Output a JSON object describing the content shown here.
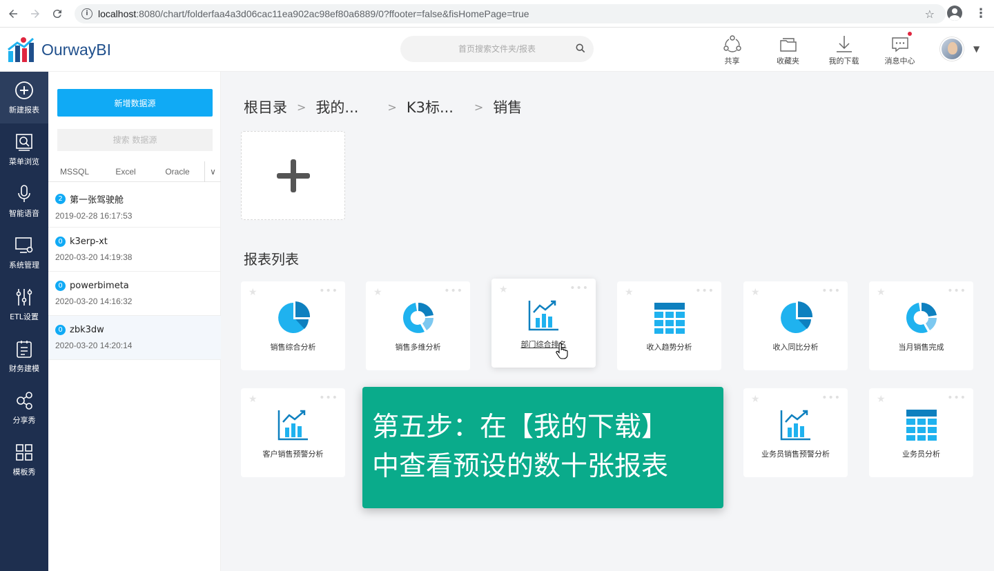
{
  "browser": {
    "url_host": "localhost",
    "url_rest": ":8080/chart/folderfaa4a3d06cac11ea902ac98ef80a6889/0?ffooter=false&fisHomePage=true"
  },
  "header": {
    "logo_text": "OurwayBI",
    "search_placeholder": "首页搜索文件夹/报表",
    "tools": [
      {
        "label": "共享",
        "icon": "share-icon"
      },
      {
        "label": "收藏夹",
        "icon": "favorites-icon"
      },
      {
        "label": "我的下载",
        "icon": "download-icon"
      },
      {
        "label": "消息中心",
        "icon": "message-icon"
      }
    ],
    "notification_color": "#e0263f"
  },
  "nav": {
    "items": [
      {
        "label": "新建报表",
        "icon": "plus-circle-icon"
      },
      {
        "label": "菜单浏览",
        "icon": "menu-browse-icon"
      },
      {
        "label": "智能语音",
        "icon": "microphone-icon"
      },
      {
        "label": "系统管理",
        "icon": "monitor-gear-icon"
      },
      {
        "label": "ETL设置",
        "icon": "sliders-icon"
      },
      {
        "label": "财务建模",
        "icon": "clipboard-icon"
      },
      {
        "label": "分享秀",
        "icon": "share-nodes-icon"
      },
      {
        "label": "模板秀",
        "icon": "grid-icon"
      }
    ]
  },
  "sources": {
    "add_label": "新增数据源",
    "search_placeholder": "搜索 数据源",
    "tabs": [
      "MSSQL",
      "Excel",
      "Oracle"
    ],
    "items": [
      {
        "count": "2",
        "name": "第一张驾驶舱",
        "time": "2019-02-28 16:17:53"
      },
      {
        "count": "0",
        "name": "k3erp-xt",
        "time": "2020-03-20 14:19:38"
      },
      {
        "count": "0",
        "name": "powerbimeta",
        "time": "2020-03-20 14:16:32"
      },
      {
        "count": "0",
        "name": "zbk3dw",
        "time": "2020-03-20 14:20:14"
      }
    ]
  },
  "main": {
    "breadcrumb": [
      "根目录",
      "我的...",
      "K3标...",
      "销售"
    ],
    "section_title": "报表列表",
    "reports": [
      {
        "label": "销售综合分析",
        "icon": "pie-chart-icon"
      },
      {
        "label": "销售多维分析",
        "icon": "donut-chart-icon"
      },
      {
        "label": "部门综合排名",
        "icon": "bar-chart-icon"
      },
      {
        "label": "收入趋势分析",
        "icon": "table-icon"
      },
      {
        "label": "收入同比分析",
        "icon": "pie-chart-icon"
      },
      {
        "label": "当月销售完成",
        "icon": "donut-chart-icon"
      },
      {
        "label": "客户销售预警分析",
        "icon": "bar-chart-icon"
      },
      {
        "label": "业务员销售预警分析",
        "icon": "bar-chart-icon"
      },
      {
        "label": "业务员分析",
        "icon": "table-icon"
      }
    ]
  },
  "overlay": {
    "line1": "第五步：在【我的下载】",
    "line2": "中查看预设的数十张报表",
    "color": "#0aab8b"
  },
  "colors": {
    "accent": "#10aaf5",
    "nav_bg": "#1e2f4f",
    "icon_dark": "#0e80bf",
    "icon_light": "#1fb2ef"
  }
}
